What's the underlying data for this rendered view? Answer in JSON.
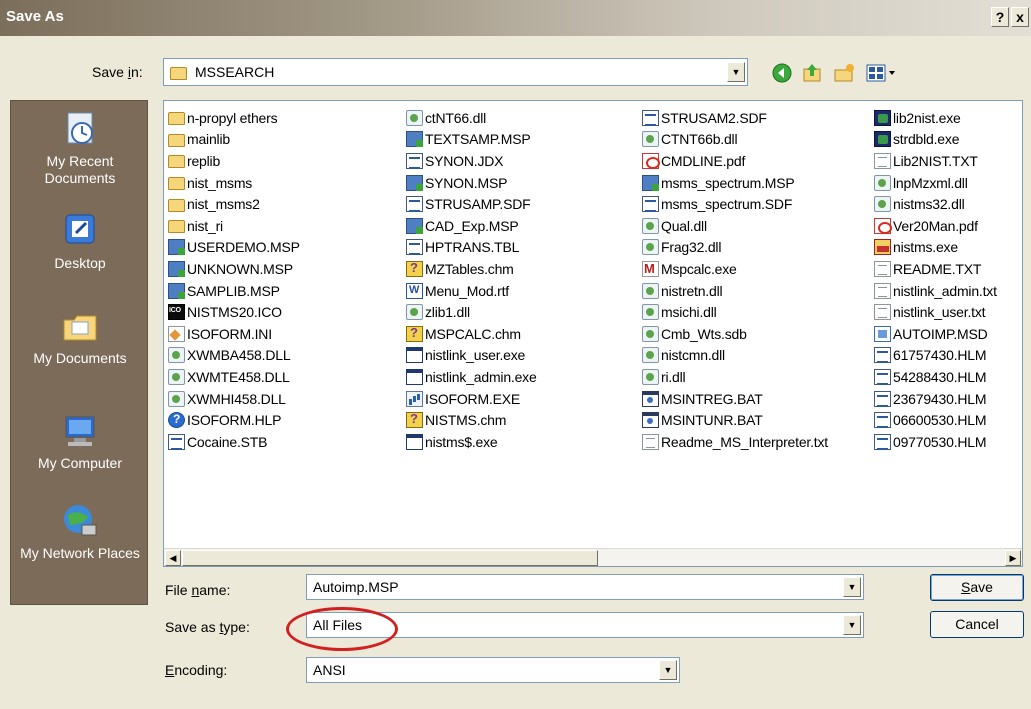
{
  "window": {
    "title": "Save As",
    "help_btn": "?",
    "close_btn": "x"
  },
  "save_in": {
    "label_pre": "Save ",
    "label_key": "i",
    "label_post": "n:",
    "value": "MSSEARCH"
  },
  "places": [
    {
      "label": "My Recent Documents",
      "icon": "recent-documents-icon"
    },
    {
      "label": "Desktop",
      "icon": "desktop-icon"
    },
    {
      "label": "My Documents",
      "icon": "my-documents-icon"
    },
    {
      "label": "My Computer",
      "icon": "my-computer-icon"
    },
    {
      "label": "My Network Places",
      "icon": "network-places-icon"
    }
  ],
  "files": {
    "col1": [
      {
        "name": "n-propyl ethers",
        "icon": "folder"
      },
      {
        "name": "mainlib",
        "icon": "folder"
      },
      {
        "name": "replib",
        "icon": "folder"
      },
      {
        "name": "nist_msms",
        "icon": "folder"
      },
      {
        "name": "nist_msms2",
        "icon": "folder"
      },
      {
        "name": "nist_ri",
        "icon": "folder"
      },
      {
        "name": "USERDEMO.MSP",
        "icon": "msp"
      },
      {
        "name": "UNKNOWN.MSP",
        "icon": "msp"
      },
      {
        "name": "SAMPLIB.MSP",
        "icon": "msp"
      },
      {
        "name": "NISTMS20.ICO",
        "icon": "ico"
      },
      {
        "name": "ISOFORM.INI",
        "icon": "ini"
      },
      {
        "name": "XWMBA458.DLL",
        "icon": "dll"
      },
      {
        "name": "XWMTE458.DLL",
        "icon": "dll"
      },
      {
        "name": "XWMHI458.DLL",
        "icon": "dll"
      },
      {
        "name": "ISOFORM.HLP",
        "icon": "hlp"
      },
      {
        "name": "Cocaine.STB",
        "icon": "sdf"
      }
    ],
    "col2": [
      {
        "name": "ctNT66.dll",
        "icon": "dll"
      },
      {
        "name": "TEXTSAMP.MSP",
        "icon": "msp"
      },
      {
        "name": "SYNON.JDX",
        "icon": "sdf"
      },
      {
        "name": "SYNON.MSP",
        "icon": "msp"
      },
      {
        "name": "STRUSAMP.SDF",
        "icon": "sdf"
      },
      {
        "name": "CAD_Exp.MSP",
        "icon": "msp"
      },
      {
        "name": "HPTRANS.TBL",
        "icon": "sdf"
      },
      {
        "name": "MZTables.chm",
        "icon": "chm"
      },
      {
        "name": "Menu_Mod.rtf",
        "icon": "rtf"
      },
      {
        "name": "zlib1.dll",
        "icon": "dll"
      },
      {
        "name": "MSPCALC.chm",
        "icon": "chm"
      },
      {
        "name": "nistlink_user.exe",
        "icon": "exe"
      },
      {
        "name": "nistlink_admin.exe",
        "icon": "exe"
      },
      {
        "name": "ISOFORM.EXE",
        "icon": "exe2"
      },
      {
        "name": "NISTMS.chm",
        "icon": "chm"
      },
      {
        "name": "nistms$.exe",
        "icon": "exe"
      }
    ],
    "col3": [
      {
        "name": "STRUSAM2.SDF",
        "icon": "sdf"
      },
      {
        "name": "CTNT66b.dll",
        "icon": "dll"
      },
      {
        "name": "CMDLINE.pdf",
        "icon": "pdf"
      },
      {
        "name": "msms_spectrum.MSP",
        "icon": "msp"
      },
      {
        "name": "msms_spectrum.SDF",
        "icon": "sdf"
      },
      {
        "name": "Qual.dll",
        "icon": "dll"
      },
      {
        "name": "Frag32.dll",
        "icon": "dll"
      },
      {
        "name": "Mspcalc.exe",
        "icon": "msexe"
      },
      {
        "name": "nistretn.dll",
        "icon": "dll"
      },
      {
        "name": "msichi.dll",
        "icon": "dll"
      },
      {
        "name": "Cmb_Wts.sdb",
        "icon": "dll"
      },
      {
        "name": "nistcmn.dll",
        "icon": "dll"
      },
      {
        "name": "ri.dll",
        "icon": "dll"
      },
      {
        "name": "MSINTREG.BAT",
        "icon": "bat"
      },
      {
        "name": "MSINTUNR.BAT",
        "icon": "bat"
      },
      {
        "name": "Readme_MS_Interpreter.txt",
        "icon": "txt"
      }
    ],
    "col4": [
      {
        "name": "lib2nist.exe",
        "icon": "lib"
      },
      {
        "name": "strdbld.exe",
        "icon": "lib"
      },
      {
        "name": "Lib2NIST.TXT",
        "icon": "txt"
      },
      {
        "name": "lnpMzxml.dll",
        "icon": "dll"
      },
      {
        "name": "nistms32.dll",
        "icon": "dll"
      },
      {
        "name": "Ver20Man.pdf",
        "icon": "pdf"
      },
      {
        "name": "nistms.exe",
        "icon": "nexe"
      },
      {
        "name": "README.TXT",
        "icon": "txt"
      },
      {
        "name": "nistlink_admin.txt",
        "icon": "txt"
      },
      {
        "name": "nistlink_user.txt",
        "icon": "txt"
      },
      {
        "name": "AUTOIMP.MSD",
        "icon": "msd"
      },
      {
        "name": "61757430.HLM",
        "icon": "sdf"
      },
      {
        "name": "54288430.HLM",
        "icon": "sdf"
      },
      {
        "name": "23679430.HLM",
        "icon": "sdf"
      },
      {
        "name": "06600530.HLM",
        "icon": "sdf"
      },
      {
        "name": "09770530.HLM",
        "icon": "sdf"
      }
    ]
  },
  "fields": {
    "filename_label_pre": "File ",
    "filename_label_key": "n",
    "filename_label_post": "ame:",
    "filename_value": "Autoimp.MSP",
    "savetype_label_pre": "Save as ",
    "savetype_label_key": "t",
    "savetype_label_post": "ype:",
    "savetype_value": "All Files",
    "encoding_label_key": "E",
    "encoding_label_post": "ncoding:",
    "encoding_value": "ANSI"
  },
  "buttons": {
    "save_key": "S",
    "save_post": "ave",
    "cancel": "Cancel"
  },
  "colors": {
    "places_bg": "#7c6b58",
    "highlight_circle": "#d02020"
  }
}
